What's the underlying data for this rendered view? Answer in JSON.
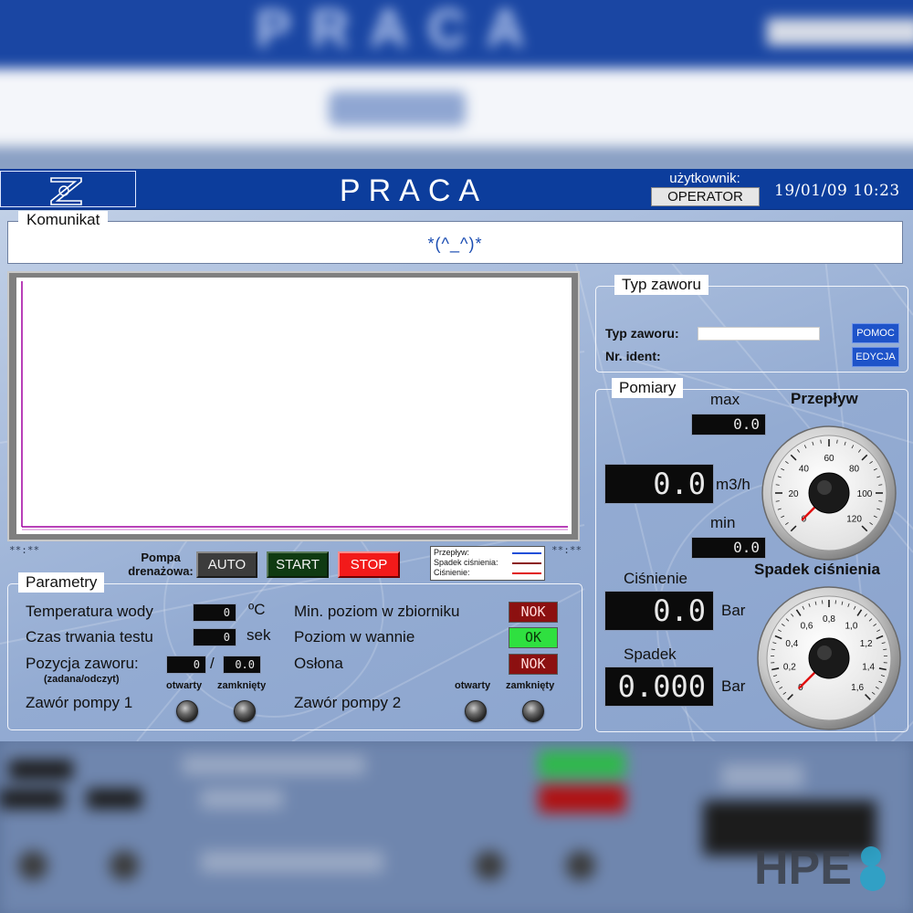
{
  "header": {
    "title": "PRACA",
    "user_label": "użytkownik:",
    "user_value": "OPERATOR",
    "datetime": "19/01/09  10:23"
  },
  "message": {
    "label": "Komunikat",
    "text": "*(^_^)*"
  },
  "chart": {
    "left_marker": "**:**",
    "right_marker": "**:**",
    "legend": [
      {
        "label": "Przepływ:",
        "color": "#1e4fd8"
      },
      {
        "label": "Spadek ciśnienia:",
        "color": "#8b1a1a"
      },
      {
        "label": "Ciśnienie:",
        "color": "#e01010"
      }
    ]
  },
  "pump": {
    "label_line1": "Pompa",
    "label_line2": "drenażowa:",
    "auto": "AUTO",
    "start": "START",
    "stop": "STOP"
  },
  "parametry": {
    "title": "Parametry",
    "temp_label": "Temperatura wody",
    "temp_value": "0",
    "temp_unit": "ºC",
    "time_label": "Czas trwania testu",
    "time_value": "0",
    "time_unit": "sek",
    "pos_label": "Pozycja zaworu:",
    "pos_sub": "(zadana/odczyt)",
    "pos_set": "0",
    "pos_sep": "/",
    "pos_read": "0.0",
    "pump1_label": "Zawór pompy 1",
    "pump2_label": "Zawór pompy 2",
    "open_label": "otwarty",
    "closed_label": "zamknięty",
    "min_level_label": "Min. poziom w zbiorniku",
    "min_level_status": "NOK",
    "bath_level_label": "Poziom w wannie",
    "bath_level_status": "OK",
    "cover_label": "Osłona",
    "cover_status": "NOK"
  },
  "typ_zaworu": {
    "title": "Typ zaworu",
    "type_label": "Typ zaworu:",
    "type_value": "",
    "ident_label": "Nr. ident:",
    "pomoc": "POMOC",
    "edycja": "EDYCJA"
  },
  "pomiary": {
    "title": "Pomiary",
    "max_label": "max",
    "max_value": "0.0",
    "flow_value": "0.0",
    "flow_unit": "m3/h",
    "min_label": "min",
    "min_value": "0.0",
    "pressure_label": "Ciśnienie",
    "pressure_value": "0.0",
    "pressure_unit": "Bar",
    "drop_label": "Spadek",
    "drop_value": "0.000",
    "drop_unit": "Bar",
    "flow_gauge_title": "Przepływ",
    "flow_gauge_ticks": [
      "0",
      "20",
      "40",
      "60",
      "80",
      "100",
      "120"
    ],
    "drop_gauge_title": "Spadek ciśnienia",
    "drop_gauge_ticks": [
      "0",
      "0,2",
      "0,4",
      "0,6",
      "0,8",
      "1,0",
      "1,2",
      "1,4",
      "1,6"
    ]
  },
  "watermark": "HPE"
}
